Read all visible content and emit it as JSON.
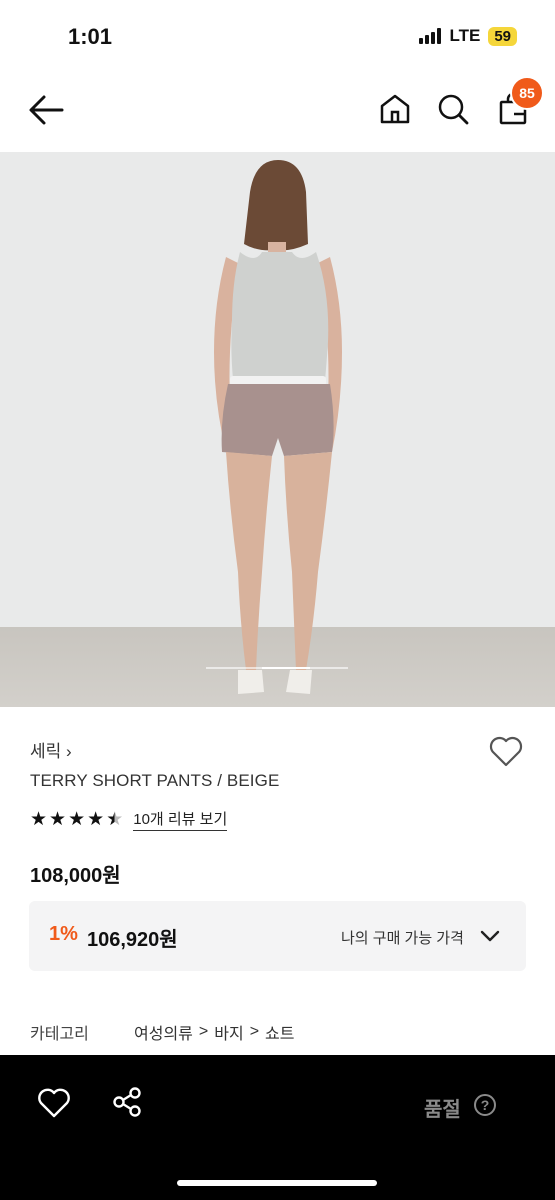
{
  "status_bar": {
    "time": "1:01",
    "network": "LTE",
    "battery": "59"
  },
  "nav": {
    "cart_count": "85"
  },
  "product": {
    "brand": "세릭",
    "brand_chevron": "›",
    "name": "TERRY SHORT PANTS / BEIGE",
    "rating": 4.5,
    "review_link": "10개 리뷰 보기",
    "price": "108,000원"
  },
  "promo": {
    "rate": "1%",
    "amount": "106,920원",
    "my_price_label": "나의 구매 가능 가격"
  },
  "category": {
    "label": "카테고리",
    "path": [
      "여성의류",
      "바지",
      "쇼트"
    ],
    "separator": ">"
  },
  "bottom_bar": {
    "sold_out": "품절",
    "help": "?"
  },
  "colors": {
    "accent": "#f05a1a",
    "bottom_bar": "#000000",
    "battery": "#f5d63a"
  },
  "icons": [
    "back-arrow-icon",
    "home-icon",
    "search-icon",
    "shopping-bag-icon",
    "heart-icon",
    "share-icon",
    "chevron-down-icon",
    "question-icon"
  ]
}
